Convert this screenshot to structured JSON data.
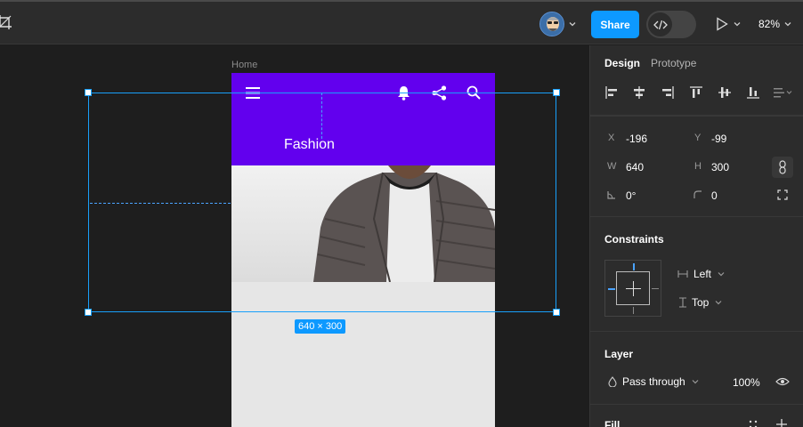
{
  "toolbar": {
    "share_label": "Share",
    "zoom": "82%"
  },
  "canvas": {
    "frame_label": "Home",
    "app": {
      "title": "Fashion"
    },
    "selection_size": "640 × 300"
  },
  "panel": {
    "tabs": [
      {
        "label": "Design"
      },
      {
        "label": "Prototype"
      }
    ],
    "transform": {
      "x_label": "X",
      "x": "-196",
      "y_label": "Y",
      "y": "-99",
      "w_label": "W",
      "w": "640",
      "h_label": "H",
      "h": "300",
      "rotation": "0°",
      "radius": "0"
    },
    "constraints": {
      "title": "Constraints",
      "horizontal": "Left",
      "vertical": "Top"
    },
    "layer": {
      "title": "Layer",
      "blend": "Pass through",
      "opacity": "100%"
    },
    "fill": {
      "title": "Fill"
    }
  },
  "colors": {
    "accent": "#0d99ff",
    "app_bar": "#6200ee",
    "panel_bg": "#2c2c2c",
    "canvas_bg": "#1e1e1e"
  },
  "icons": [
    "crop-icon",
    "avatar",
    "chevron-down-icon",
    "dev-mode-icon",
    "play-icon",
    "menu-icon",
    "bell-icon",
    "share-icon",
    "search-icon",
    "align-left-icon",
    "align-center-h-icon",
    "align-right-icon",
    "align-top-icon",
    "align-middle-v-icon",
    "align-bottom-icon",
    "distribute-icon",
    "clip-content-icon",
    "resize-icon",
    "eye-icon",
    "opacity-drop-icon",
    "grid-dots-icon",
    "plus-icon"
  ]
}
